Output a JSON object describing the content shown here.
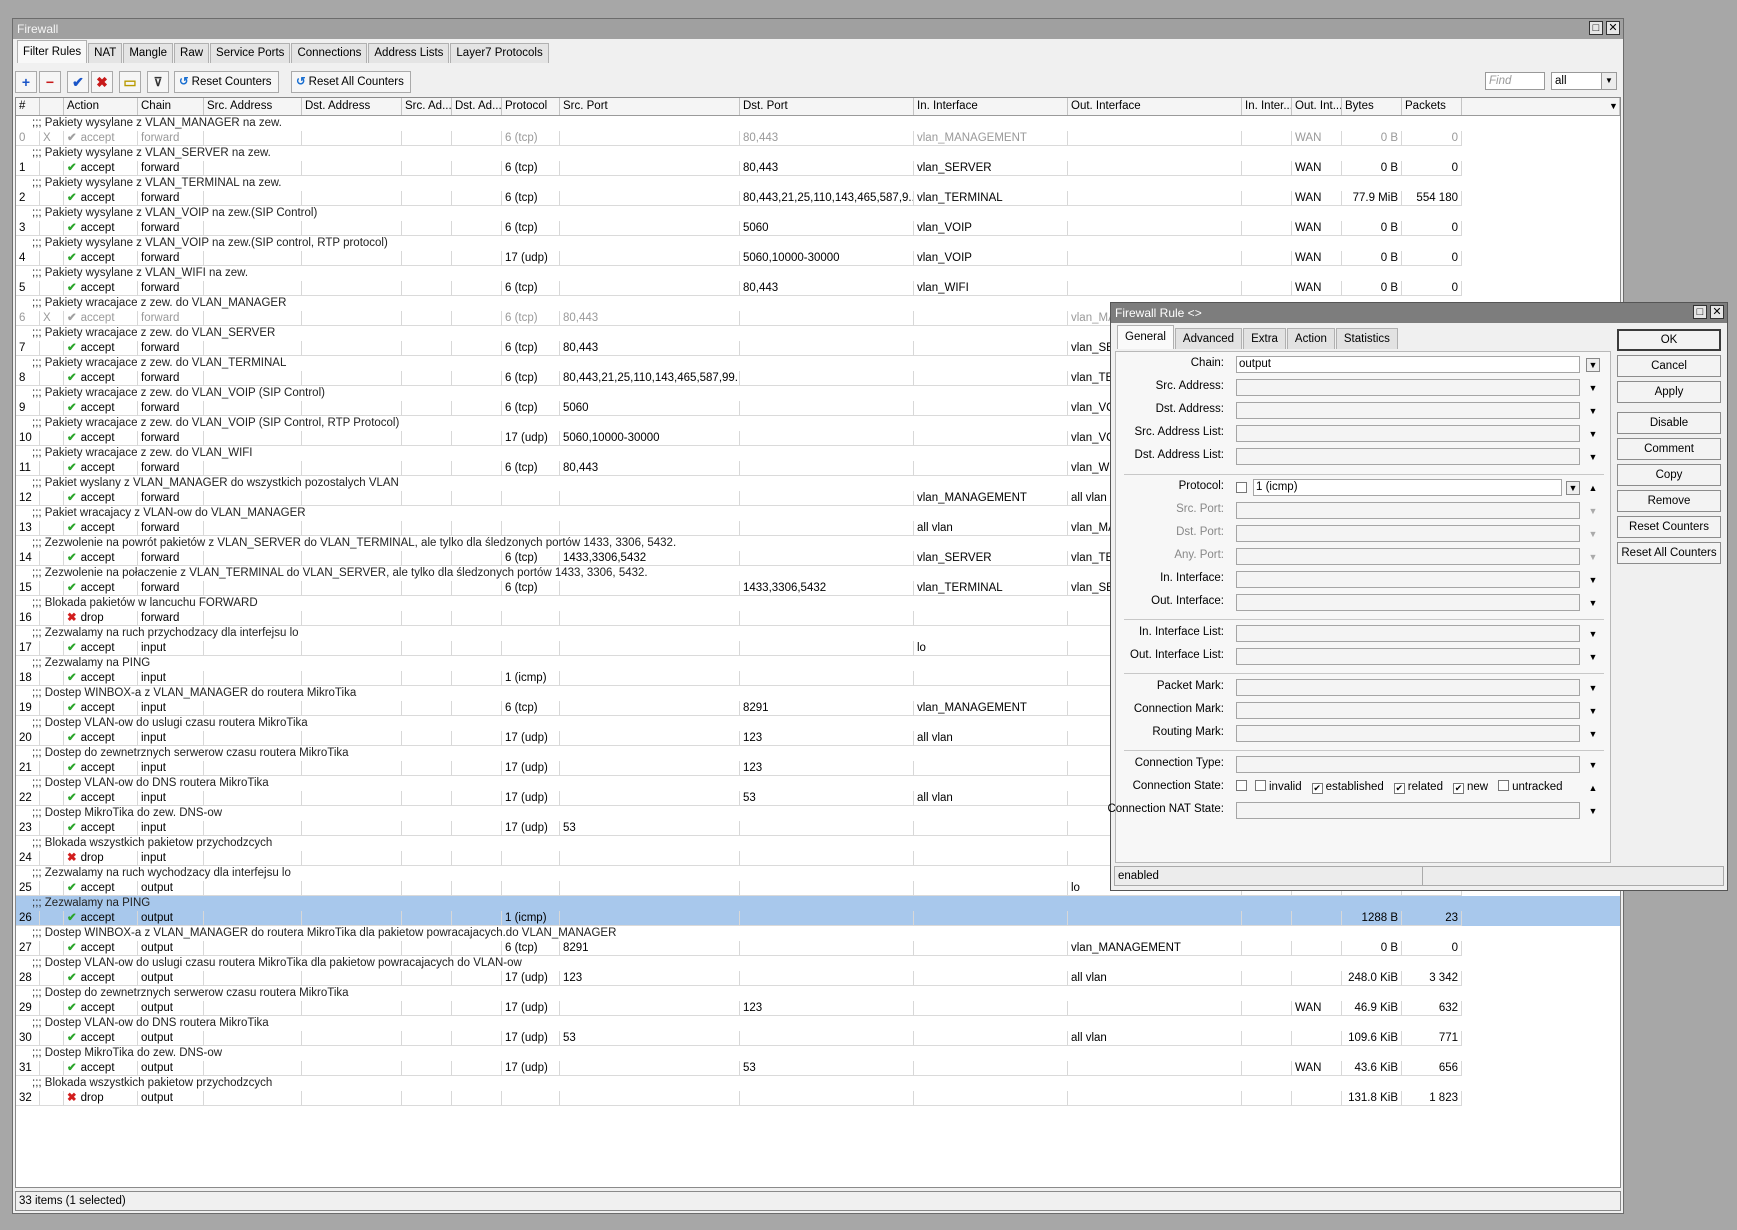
{
  "firewall": {
    "title": "Firewall",
    "tabs": [
      "Filter Rules",
      "NAT",
      "Mangle",
      "Raw",
      "Service Ports",
      "Connections",
      "Address Lists",
      "Layer7 Protocols"
    ],
    "toolbar": {
      "reset_counters": "Reset Counters",
      "reset_all_counters": "Reset All Counters",
      "find_placeholder": "Find",
      "filter_value": "all"
    },
    "columns": [
      "#",
      "",
      "Action",
      "Chain",
      "Src. Address",
      "Dst. Address",
      "Src. Ad...",
      "Dst. Ad...",
      "Protocol",
      "Src. Port",
      "Dst. Port",
      "In. Interface",
      "Out. Interface",
      "In. Inter...",
      "Out. Int...",
      "Bytes",
      "Packets"
    ],
    "rows": [
      {
        "type": "comment",
        "text": ";;; Pakiety wysylane z VLAN_MANAGER na zew.",
        "disabled": true
      },
      {
        "type": "rule",
        "num": "0",
        "flag": "X",
        "action": "accept",
        "chain": "forward",
        "protocol": "6 (tcp)",
        "src_port": "",
        "dst_port": "80,443",
        "in_if": "vlan_MANAGEMENT",
        "out_if": "",
        "in_list": "",
        "out_list": "WAN",
        "bytes": "0 B",
        "packets": "0",
        "disabled": true
      },
      {
        "type": "comment",
        "text": ";;; Pakiety wysylane z VLAN_SERVER na zew."
      },
      {
        "type": "rule",
        "num": "1",
        "flag": "",
        "action": "accept",
        "chain": "forward",
        "protocol": "6 (tcp)",
        "src_port": "",
        "dst_port": "80,443",
        "in_if": "vlan_SERVER",
        "out_if": "",
        "in_list": "",
        "out_list": "WAN",
        "bytes": "0 B",
        "packets": "0"
      },
      {
        "type": "comment",
        "text": ";;; Pakiety wysylane z VLAN_TERMINAL na zew."
      },
      {
        "type": "rule",
        "num": "2",
        "flag": "",
        "action": "accept",
        "chain": "forward",
        "protocol": "6 (tcp)",
        "src_port": "",
        "dst_port": "80,443,21,25,110,143,465,587,9...",
        "in_if": "vlan_TERMINAL",
        "out_if": "",
        "in_list": "",
        "out_list": "WAN",
        "bytes": "77.9 MiB",
        "packets": "554 180"
      },
      {
        "type": "comment",
        "text": ";;; Pakiety wysylane z VLAN_VOIP na zew.(SIP Control)"
      },
      {
        "type": "rule",
        "num": "3",
        "flag": "",
        "action": "accept",
        "chain": "forward",
        "protocol": "6 (tcp)",
        "src_port": "",
        "dst_port": "5060",
        "in_if": "vlan_VOIP",
        "out_if": "",
        "in_list": "",
        "out_list": "WAN",
        "bytes": "0 B",
        "packets": "0"
      },
      {
        "type": "comment",
        "text": ";;; Pakiety wysylane z VLAN_VOIP na zew.(SIP control, RTP protocol)"
      },
      {
        "type": "rule",
        "num": "4",
        "flag": "",
        "action": "accept",
        "chain": "forward",
        "protocol": "17 (udp)",
        "src_port": "",
        "dst_port": "5060,10000-30000",
        "in_if": "vlan_VOIP",
        "out_if": "",
        "in_list": "",
        "out_list": "WAN",
        "bytes": "0 B",
        "packets": "0"
      },
      {
        "type": "comment",
        "text": ";;; Pakiety wysylane z VLAN_WIFI na zew."
      },
      {
        "type": "rule",
        "num": "5",
        "flag": "",
        "action": "accept",
        "chain": "forward",
        "protocol": "6 (tcp)",
        "src_port": "",
        "dst_port": "80,443",
        "in_if": "vlan_WIFI",
        "out_if": "",
        "in_list": "",
        "out_list": "WAN",
        "bytes": "0 B",
        "packets": "0"
      },
      {
        "type": "comment",
        "text": ";;; Pakiety wracajace z zew. do VLAN_MANAGER",
        "disabled": true
      },
      {
        "type": "rule",
        "num": "6",
        "flag": "X",
        "action": "accept",
        "chain": "forward",
        "protocol": "6 (tcp)",
        "src_port": "80,443",
        "dst_port": "",
        "in_if": "",
        "out_if": "vlan_MA",
        "in_list": "",
        "out_list": "",
        "bytes": "",
        "packets": "",
        "disabled": true
      },
      {
        "type": "comment",
        "text": ";;; Pakiety wracajace z zew. do VLAN_SERVER"
      },
      {
        "type": "rule",
        "num": "7",
        "flag": "",
        "action": "accept",
        "chain": "forward",
        "protocol": "6 (tcp)",
        "src_port": "80,443",
        "dst_port": "",
        "in_if": "",
        "out_if": "vlan_SE",
        "in_list": "",
        "out_list": "",
        "bytes": "",
        "packets": ""
      },
      {
        "type": "comment",
        "text": ";;; Pakiety wracajace z zew. do VLAN_TERMINAL"
      },
      {
        "type": "rule",
        "num": "8",
        "flag": "",
        "action": "accept",
        "chain": "forward",
        "protocol": "6 (tcp)",
        "src_port": "80,443,21,25,110,143,465,587,99...",
        "dst_port": "",
        "in_if": "",
        "out_if": "vlan_TE",
        "in_list": "",
        "out_list": "",
        "bytes": "",
        "packets": ""
      },
      {
        "type": "comment",
        "text": ";;; Pakiety wracajace z zew. do VLAN_VOIP (SIP Control)"
      },
      {
        "type": "rule",
        "num": "9",
        "flag": "",
        "action": "accept",
        "chain": "forward",
        "protocol": "6 (tcp)",
        "src_port": "5060",
        "dst_port": "",
        "in_if": "",
        "out_if": "vlan_VC",
        "in_list": "",
        "out_list": "",
        "bytes": "",
        "packets": ""
      },
      {
        "type": "comment",
        "text": ";;; Pakiety wracajace z zew. do VLAN_VOIP (SIP Control, RTP Protocol)"
      },
      {
        "type": "rule",
        "num": "10",
        "flag": "",
        "action": "accept",
        "chain": "forward",
        "protocol": "17 (udp)",
        "src_port": "5060,10000-30000",
        "dst_port": "",
        "in_if": "",
        "out_if": "vlan_VC",
        "in_list": "",
        "out_list": "",
        "bytes": "",
        "packets": ""
      },
      {
        "type": "comment",
        "text": ";;; Pakiety wracajace z zew. do VLAN_WIFI"
      },
      {
        "type": "rule",
        "num": "11",
        "flag": "",
        "action": "accept",
        "chain": "forward",
        "protocol": "6 (tcp)",
        "src_port": "80,443",
        "dst_port": "",
        "in_if": "",
        "out_if": "vlan_W",
        "in_list": "",
        "out_list": "",
        "bytes": "",
        "packets": ""
      },
      {
        "type": "comment",
        "text": ";;; Pakiet wyslany z VLAN_MANAGER do wszystkich pozostalych VLAN"
      },
      {
        "type": "rule",
        "num": "12",
        "flag": "",
        "action": "accept",
        "chain": "forward",
        "protocol": "",
        "src_port": "",
        "dst_port": "",
        "in_if": "vlan_MANAGEMENT",
        "out_if": "all vlan",
        "in_list": "",
        "out_list": "",
        "bytes": "",
        "packets": ""
      },
      {
        "type": "comment",
        "text": ";;; Pakiet wracajacy z VLAN-ow do VLAN_MANAGER"
      },
      {
        "type": "rule",
        "num": "13",
        "flag": "",
        "action": "accept",
        "chain": "forward",
        "protocol": "",
        "src_port": "",
        "dst_port": "",
        "in_if": "all vlan",
        "out_if": "vlan_MA",
        "in_list": "",
        "out_list": "",
        "bytes": "",
        "packets": ""
      },
      {
        "type": "comment",
        "text": ";;; Zezwolenie na powrót pakietów z VLAN_SERVER do VLAN_TERMINAL, ale tylko dla śledzonych portów 1433, 3306, 5432."
      },
      {
        "type": "rule",
        "num": "14",
        "flag": "",
        "action": "accept",
        "chain": "forward",
        "protocol": "6 (tcp)",
        "src_port": "1433,3306,5432",
        "dst_port": "",
        "in_if": "vlan_SERVER",
        "out_if": "vlan_TE",
        "in_list": "",
        "out_list": "",
        "bytes": "",
        "packets": ""
      },
      {
        "type": "comment",
        "text": ";;; Zezwolenie na połaczenie z VLAN_TERMINAL do VLAN_SERVER, ale tylko dla śledzonych portów 1433, 3306, 5432."
      },
      {
        "type": "rule",
        "num": "15",
        "flag": "",
        "action": "accept",
        "chain": "forward",
        "protocol": "6 (tcp)",
        "src_port": "",
        "dst_port": "1433,3306,5432",
        "in_if": "vlan_TERMINAL",
        "out_if": "vlan_SE",
        "in_list": "",
        "out_list": "",
        "bytes": "",
        "packets": ""
      },
      {
        "type": "comment",
        "text": ";;; Blokada pakietów w lancuchu FORWARD"
      },
      {
        "type": "rule",
        "num": "16",
        "flag": "",
        "action": "drop",
        "chain": "forward",
        "protocol": "",
        "src_port": "",
        "dst_port": "",
        "in_if": "",
        "out_if": "",
        "in_list": "",
        "out_list": "",
        "bytes": "",
        "packets": ""
      },
      {
        "type": "comment",
        "text": ";;; Zezwalamy na ruch przychodzacy dla interfejsu lo"
      },
      {
        "type": "rule",
        "num": "17",
        "flag": "",
        "action": "accept",
        "chain": "input",
        "protocol": "",
        "src_port": "",
        "dst_port": "",
        "in_if": "lo",
        "out_if": "",
        "in_list": "",
        "out_list": "",
        "bytes": "",
        "packets": ""
      },
      {
        "type": "comment",
        "text": ";;; Zezwalamy na PING"
      },
      {
        "type": "rule",
        "num": "18",
        "flag": "",
        "action": "accept",
        "chain": "input",
        "protocol": "1 (icmp)",
        "src_port": "",
        "dst_port": "",
        "in_if": "",
        "out_if": "",
        "in_list": "",
        "out_list": "",
        "bytes": "",
        "packets": ""
      },
      {
        "type": "comment",
        "text": ";;; Dostep WINBOX-a z VLAN_MANAGER do routera MikroTika"
      },
      {
        "type": "rule",
        "num": "19",
        "flag": "",
        "action": "accept",
        "chain": "input",
        "protocol": "6 (tcp)",
        "src_port": "",
        "dst_port": "8291",
        "in_if": "vlan_MANAGEMENT",
        "out_if": "",
        "in_list": "",
        "out_list": "",
        "bytes": "",
        "packets": ""
      },
      {
        "type": "comment",
        "text": ";;; Dostep VLAN-ow do uslugi czasu routera MikroTika"
      },
      {
        "type": "rule",
        "num": "20",
        "flag": "",
        "action": "accept",
        "chain": "input",
        "protocol": "17 (udp)",
        "src_port": "",
        "dst_port": "123",
        "in_if": "all vlan",
        "out_if": "",
        "in_list": "",
        "out_list": "",
        "bytes": "",
        "packets": ""
      },
      {
        "type": "comment",
        "text": ";;; Dostep do zewnetrznych serwerow czasu routera MikroTika"
      },
      {
        "type": "rule",
        "num": "21",
        "flag": "",
        "action": "accept",
        "chain": "input",
        "protocol": "17 (udp)",
        "src_port": "",
        "dst_port": "123",
        "in_if": "",
        "out_if": "",
        "in_list": "",
        "out_list": "",
        "bytes": "",
        "packets": ""
      },
      {
        "type": "comment",
        "text": ";;; Dostep VLAN-ow do DNS routera MikroTika"
      },
      {
        "type": "rule",
        "num": "22",
        "flag": "",
        "action": "accept",
        "chain": "input",
        "protocol": "17 (udp)",
        "src_port": "",
        "dst_port": "53",
        "in_if": "all vlan",
        "out_if": "",
        "in_list": "",
        "out_list": "",
        "bytes": "",
        "packets": ""
      },
      {
        "type": "comment",
        "text": ";;; Dostep MikroTika do zew. DNS-ow"
      },
      {
        "type": "rule",
        "num": "23",
        "flag": "",
        "action": "accept",
        "chain": "input",
        "protocol": "17 (udp)",
        "src_port": "53",
        "dst_port": "",
        "in_if": "",
        "out_if": "",
        "in_list": "",
        "out_list": "",
        "bytes": "",
        "packets": ""
      },
      {
        "type": "comment",
        "text": ";;; Blokada wszystkich pakietow przychodzcych"
      },
      {
        "type": "rule",
        "num": "24",
        "flag": "",
        "action": "drop",
        "chain": "input",
        "protocol": "",
        "src_port": "",
        "dst_port": "",
        "in_if": "",
        "out_if": "",
        "in_list": "",
        "out_list": "",
        "bytes": "",
        "packets": ""
      },
      {
        "type": "comment",
        "text": ";;; Zezwalamy na ruch wychodzacy dla interfejsu lo"
      },
      {
        "type": "rule",
        "num": "25",
        "flag": "",
        "action": "accept",
        "chain": "output",
        "protocol": "",
        "src_port": "",
        "dst_port": "",
        "in_if": "",
        "out_if": "lo",
        "in_list": "",
        "out_list": "",
        "bytes": "",
        "packets": ""
      },
      {
        "type": "comment",
        "text": ";;; Zezwalamy na PING",
        "selected": true
      },
      {
        "type": "rule",
        "num": "26",
        "flag": "",
        "action": "accept",
        "chain": "output",
        "protocol": "1 (icmp)",
        "src_port": "",
        "dst_port": "",
        "in_if": "",
        "out_if": "",
        "in_list": "",
        "out_list": "",
        "bytes": "1288 B",
        "packets": "23",
        "selected": true
      },
      {
        "type": "comment",
        "text": ";;; Dostep WINBOX-a z VLAN_MANAGER do routera MikroTika dla pakietow powracajacych.do VLAN_MANAGER"
      },
      {
        "type": "rule",
        "num": "27",
        "flag": "",
        "action": "accept",
        "chain": "output",
        "protocol": "6 (tcp)",
        "src_port": "8291",
        "dst_port": "",
        "in_if": "",
        "out_if": "vlan_MANAGEMENT",
        "in_list": "",
        "out_list": "",
        "bytes": "0 B",
        "packets": "0"
      },
      {
        "type": "comment",
        "text": ";;; Dostep VLAN-ow do uslugi czasu routera MikroTika dla pakietow powracajacych do VLAN-ow"
      },
      {
        "type": "rule",
        "num": "28",
        "flag": "",
        "action": "accept",
        "chain": "output",
        "protocol": "17 (udp)",
        "src_port": "123",
        "dst_port": "",
        "in_if": "",
        "out_if": "all vlan",
        "in_list": "",
        "out_list": "",
        "bytes": "248.0 KiB",
        "packets": "3 342"
      },
      {
        "type": "comment",
        "text": ";;; Dostep do zewnetrznych serwerow czasu routera MikroTika"
      },
      {
        "type": "rule",
        "num": "29",
        "flag": "",
        "action": "accept",
        "chain": "output",
        "protocol": "17 (udp)",
        "src_port": "",
        "dst_port": "123",
        "in_if": "",
        "out_if": "",
        "in_list": "",
        "out_list": "WAN",
        "bytes": "46.9 KiB",
        "packets": "632"
      },
      {
        "type": "comment",
        "text": ";;; Dostep VLAN-ow do DNS routera MikroTika"
      },
      {
        "type": "rule",
        "num": "30",
        "flag": "",
        "action": "accept",
        "chain": "output",
        "protocol": "17 (udp)",
        "src_port": "53",
        "dst_port": "",
        "in_if": "",
        "out_if": "all vlan",
        "in_list": "",
        "out_list": "",
        "bytes": "109.6 KiB",
        "packets": "771"
      },
      {
        "type": "comment",
        "text": ";;; Dostep MikroTika do zew. DNS-ow"
      },
      {
        "type": "rule",
        "num": "31",
        "flag": "",
        "action": "accept",
        "chain": "output",
        "protocol": "17 (udp)",
        "src_port": "",
        "dst_port": "53",
        "in_if": "",
        "out_if": "",
        "in_list": "",
        "out_list": "WAN",
        "bytes": "43.6 KiB",
        "packets": "656"
      },
      {
        "type": "comment",
        "text": ";;; Blokada wszystkich pakietow przychodzcych"
      },
      {
        "type": "rule",
        "num": "32",
        "flag": "",
        "action": "drop",
        "chain": "output",
        "protocol": "",
        "src_port": "",
        "dst_port": "",
        "in_if": "",
        "out_if": "",
        "in_list": "",
        "out_list": "",
        "bytes": "131.8 KiB",
        "packets": "1 823"
      }
    ],
    "status": "33 items (1 selected)"
  },
  "rule_dialog": {
    "title": "Firewall Rule <>",
    "tabs": [
      "General",
      "Advanced",
      "Extra",
      "Action",
      "Statistics"
    ],
    "fields": {
      "chain_label": "Chain:",
      "chain_value": "output",
      "src_address_label": "Src. Address:",
      "dst_address_label": "Dst. Address:",
      "src_address_list_label": "Src. Address List:",
      "dst_address_list_label": "Dst. Address List:",
      "protocol_label": "Protocol:",
      "protocol_value": "1 (icmp)",
      "src_port_label": "Src. Port:",
      "dst_port_label": "Dst. Port:",
      "any_port_label": "Any. Port:",
      "in_interface_label": "In. Interface:",
      "out_interface_label": "Out. Interface:",
      "in_interface_list_label": "In. Interface List:",
      "out_interface_list_label": "Out. Interface List:",
      "packet_mark_label": "Packet Mark:",
      "connection_mark_label": "Connection Mark:",
      "routing_mark_label": "Routing Mark:",
      "connection_type_label": "Connection Type:",
      "connection_state_label": "Connection State:",
      "connection_nat_state_label": "Connection NAT State:"
    },
    "connection_states": [
      {
        "label": "invalid",
        "checked": false
      },
      {
        "label": "established",
        "checked": true
      },
      {
        "label": "related",
        "checked": true
      },
      {
        "label": "new",
        "checked": true
      },
      {
        "label": "untracked",
        "checked": false
      }
    ],
    "buttons": [
      "OK",
      "Cancel",
      "Apply",
      "Disable",
      "Comment",
      "Copy",
      "Remove",
      "Reset Counters",
      "Reset All Counters"
    ],
    "status": "enabled"
  }
}
